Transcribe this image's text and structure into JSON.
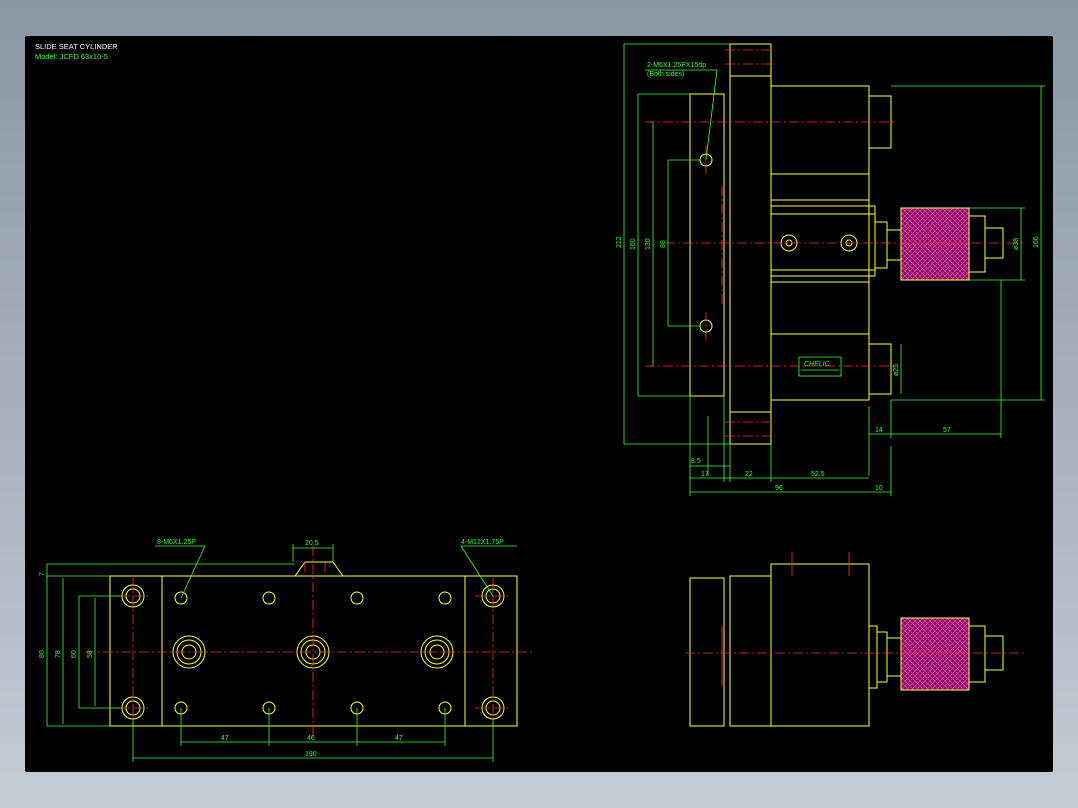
{
  "title": {
    "main": "SLIDE SEAT CYLINDER",
    "model": "Model: JCFD 63x10-5"
  },
  "labels": {
    "top_hole": "2-M6X1.25PX15dp",
    "top_hole_note": "(Both sides)",
    "front_left_hole": "8-M6X1.25P",
    "front_right_hole": "4-M12X1.75P",
    "brand": "CHELIC"
  },
  "dims": {
    "d212": "212",
    "d160": "160",
    "d130": "130",
    "d88": "88",
    "d166": "166",
    "d38": "ø38",
    "d25": "ø25",
    "d14": "14",
    "d57": "57",
    "d8_5": "8.5",
    "d17": "17",
    "d22": "22",
    "d52_5": "52.5",
    "d96": "96",
    "d10": "10",
    "d20_5": "20.5",
    "d7": "7",
    "d80": "80",
    "d78": "78",
    "d60": "60",
    "d58": "58",
    "d47a": "47",
    "d46": "46",
    "d47b": "47",
    "d190": "190"
  },
  "colors": {
    "outline": "#ffff3a",
    "dimension": "#35ff35",
    "centerline": "#ff3030",
    "knob": "#c0167a"
  }
}
